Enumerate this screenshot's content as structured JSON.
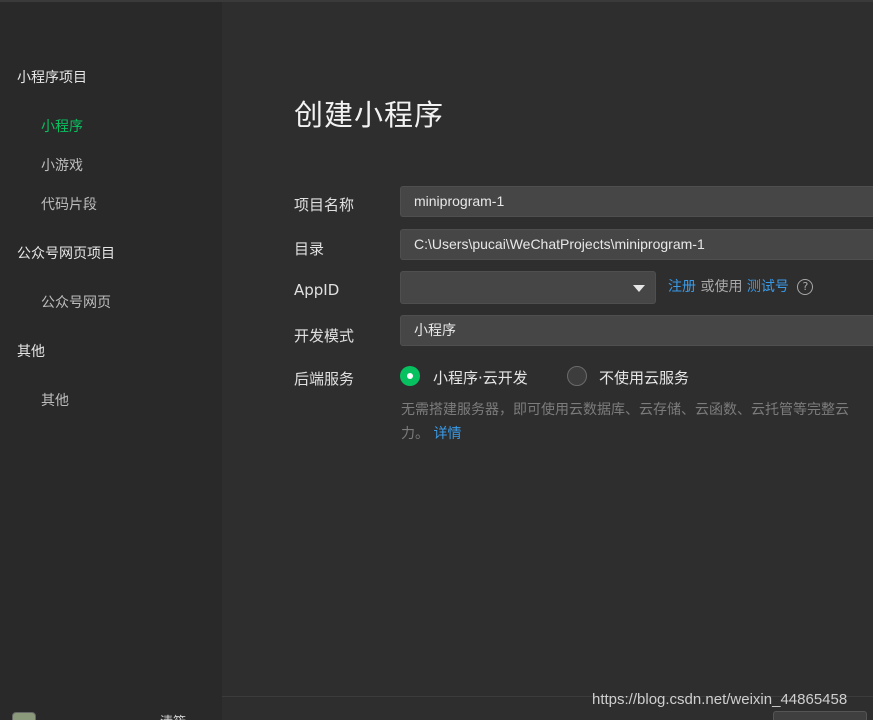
{
  "sidebar": {
    "categories": [
      {
        "label": "小程序项目"
      },
      {
        "label": "公众号网页项目"
      },
      {
        "label": "其他"
      }
    ],
    "items": [
      {
        "label": "小程序",
        "active": true
      },
      {
        "label": "小游戏"
      },
      {
        "label": "代码片段"
      },
      {
        "label": "公众号网页"
      },
      {
        "label": "其他"
      }
    ],
    "user_name": "清筱"
  },
  "form": {
    "title": "创建小程序",
    "project_name": {
      "label": "项目名称",
      "value": "miniprogram-1"
    },
    "directory": {
      "label": "目录",
      "value": "C:\\Users\\pucai\\WeChatProjects\\miniprogram-1"
    },
    "appid": {
      "label": "AppID",
      "value": "",
      "register_link": "注册",
      "or_use_text": "或使用",
      "test_id_link": "测试号",
      "help_icon": "?"
    },
    "dev_mode": {
      "label": "开发模式",
      "value": "小程序"
    },
    "backend": {
      "label": "后端服务",
      "options": [
        {
          "label": "小程序·云开发",
          "selected": true
        },
        {
          "label": "不使用云服务",
          "selected": false
        }
      ],
      "description": "无需搭建服务器，即可使用云数据库、云存储、云函数、云托管等完整云",
      "description_tail": "力。",
      "details_link": "详情"
    }
  },
  "watermark": "https://blog.csdn.net/weixin_44865458",
  "colors": {
    "accent": "#07c160",
    "link": "#3a9be8",
    "sidebar_bg": "#292929",
    "main_bg": "#2e2e2e"
  }
}
